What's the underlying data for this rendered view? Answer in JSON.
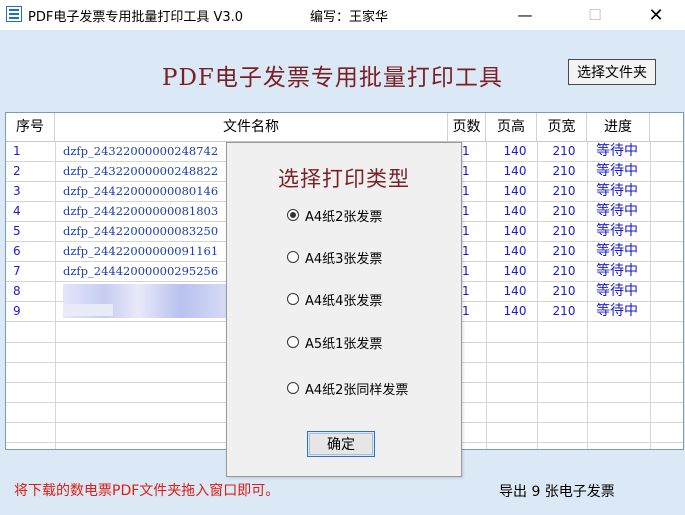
{
  "window": {
    "title": "PDF电子发票专用批量打印工具 V3.0",
    "author": "编写：王家华",
    "min_glyph": "—",
    "max_glyph": "☐",
    "close_glyph": "✕"
  },
  "header": {
    "title": "PDF电子发票专用批量打印工具",
    "select_folder_label": "选择文件夹"
  },
  "table": {
    "columns": [
      "序号",
      "文件名称",
      "页数",
      "页高",
      "页宽",
      "进度"
    ],
    "rows": [
      {
        "idx": "1",
        "name": "dzfp_24322000000248742",
        "pages": "1",
        "height": "140",
        "width": "210",
        "progress": "等待中"
      },
      {
        "idx": "2",
        "name": "dzfp_24322000000248822",
        "pages": "1",
        "height": "140",
        "width": "210",
        "progress": "等待中"
      },
      {
        "idx": "3",
        "name": "dzfp_24422000000080146",
        "pages": "1",
        "height": "140",
        "width": "210",
        "progress": "等待中"
      },
      {
        "idx": "4",
        "name": "dzfp_24422000000081803",
        "pages": "1",
        "height": "140",
        "width": "210",
        "progress": "等待中"
      },
      {
        "idx": "5",
        "name": "dzfp_24422000000083250",
        "pages": "1",
        "height": "140",
        "width": "210",
        "progress": "等待中"
      },
      {
        "idx": "6",
        "name": "dzfp_24422000000091161",
        "pages": "1",
        "height": "140",
        "width": "210",
        "progress": "等待中"
      },
      {
        "idx": "7",
        "name": "dzfp_24442000000295256",
        "pages": "1",
        "height": "140",
        "width": "210",
        "progress": "等待中"
      },
      {
        "idx": "8",
        "name": "",
        "pages": "1",
        "height": "140",
        "width": "210",
        "progress": "等待中"
      },
      {
        "idx": "9",
        "name": "",
        "pages": "1",
        "height": "140",
        "width": "210",
        "progress": "等待中"
      }
    ]
  },
  "dialog": {
    "title": "选择打印类型",
    "options": [
      {
        "label": "A4纸2张发票",
        "selected": true
      },
      {
        "label": "A4纸3张发票",
        "selected": false
      },
      {
        "label": "A4纸4张发票",
        "selected": false
      },
      {
        "label": "A5纸1张发票",
        "selected": false
      },
      {
        "label": "A4纸2张同样发票",
        "selected": false
      }
    ],
    "ok_label": "确定"
  },
  "footer": {
    "hint": "将下载的数电票PDF文件夹拖入窗口即可。",
    "count_text": "导出 9 张电子发票"
  },
  "colors": {
    "window_bg": "#dbe9f6",
    "title_red": "#7a1f24",
    "row_blue": "#1a1ad0",
    "hint_red": "#e01b12"
  }
}
